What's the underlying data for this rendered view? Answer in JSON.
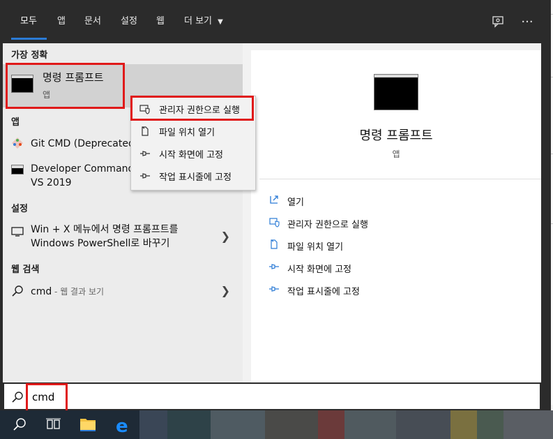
{
  "tabs": [
    "모두",
    "앱",
    "문서",
    "설정",
    "웹",
    "더 보기"
  ],
  "sections": {
    "best_match": "가장 정확",
    "apps": "앱",
    "settings": "설정",
    "web_search": "웹 검색"
  },
  "best_match": {
    "title": "명령 프롬프트",
    "subtitle": "앱"
  },
  "apps": [
    {
      "label": "Git CMD (Deprecated"
    },
    {
      "label": "Developer Command",
      "label2": "VS 2019"
    }
  ],
  "setting_item": {
    "line1": "Win + X 메뉴에서 명령 프롬프트를",
    "line2": "Windows PowerShell로 바꾸기"
  },
  "web_item": {
    "query": "cmd",
    "suffix": " - 웹 결과 보기"
  },
  "context_menu": [
    "관리자 권한으로 실행",
    "파일 위치 열기",
    "시작 화면에 고정",
    "작업 표시줄에 고정"
  ],
  "preview": {
    "title": "명령 프롬프트",
    "subtitle": "앱",
    "actions": [
      "열기",
      "관리자 권한으로 실행",
      "파일 위치 열기",
      "시작 화면에 고정",
      "작업 표시줄에 고정"
    ]
  },
  "search": {
    "value": "cmd"
  },
  "icons": {
    "feedback": "feedback-icon",
    "more": "more-icon",
    "accent": "#2b7bd6",
    "highlight_red": "#e01a1a"
  }
}
